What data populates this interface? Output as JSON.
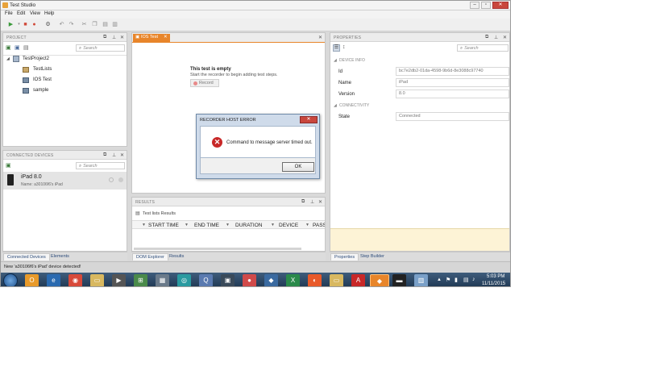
{
  "window": {
    "title": "Test Studio"
  },
  "menu": [
    "File",
    "Edit",
    "View",
    "Help"
  ],
  "project_panel": {
    "title": "PROJECT",
    "search_placeholder": "Search",
    "tree": {
      "root": "TestProject2",
      "items": [
        "TestLists",
        "IOS Test",
        "sample"
      ]
    }
  },
  "devices_panel": {
    "title": "CONNECTED DEVICES",
    "search_placeholder": "Search",
    "device": {
      "name": "iPad 8.0",
      "subtitle": "Name: a30106f6's iPad"
    }
  },
  "left_tabs": [
    "Connected Devices",
    "Elements"
  ],
  "editor": {
    "tab_label": "IOS Test",
    "empty_title": "This test is empty",
    "empty_hint": "Start the recorder to begin adding test steps.",
    "record_label": "Record"
  },
  "results_panel": {
    "title": "RESULTS",
    "subtitle": "Test lists Results",
    "columns": [
      "START TIME",
      "END TIME",
      "DURATION",
      "DEVICE",
      "PASS"
    ]
  },
  "center_tabs": [
    "DOM Explorer",
    "Results"
  ],
  "properties_panel": {
    "title": "PROPERTIES",
    "search_placeholder": "Search",
    "sections": {
      "device_info": "DEVICE INFO",
      "connectivity": "CONNECTIVITY"
    },
    "fields": [
      {
        "label": "Id",
        "value": "bc7e2db2-01da-4598-9b6d-8e3088c97740"
      },
      {
        "label": "Name",
        "value": "iPad"
      },
      {
        "label": "Version",
        "value": "8.0"
      }
    ],
    "state": {
      "label": "State",
      "value": "Connected"
    }
  },
  "right_tabs": [
    "Properties",
    "Step Builder"
  ],
  "status_bar": "New 'a30106f6's iPad' device detected!",
  "dialog": {
    "title": "RECORDER HOST ERROR",
    "message": "Command to message server timed out.",
    "ok_label": "OK"
  },
  "taskbar": {
    "time": "5:03 PM",
    "date": "11/11/2015"
  },
  "colors": {
    "accent_orange": "#e8852a",
    "error_red": "#c82828",
    "taskbar": "#2a4766",
    "properties_empty": "#fdf3d6"
  }
}
